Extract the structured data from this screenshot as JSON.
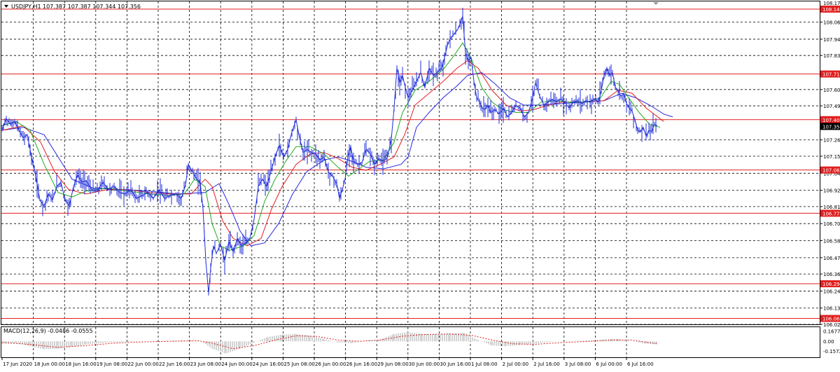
{
  "header": {
    "symbol_tf": "USDJPY,H1",
    "ohlc": "107.387 107.387 107.344 107.356",
    "dropdown_icon": "triangle-down-icon"
  },
  "macd_label": "MACD(12,26,9) -0.0486 -0.0555",
  "colors": {
    "price": "#1f2dd8",
    "ma_green": "#1faa1f",
    "ma_red": "#e02020",
    "ma_blue": "#2828e0",
    "level_line": "#e02020",
    "level_box": "#e02020",
    "current_box": "#000000",
    "grid": "#000000",
    "macd_hist": "#a8a8a8",
    "macd_signal": "#e02020"
  },
  "chart_data": {
    "type": "line",
    "title": "",
    "xlabel": "",
    "ylabel": "",
    "ylim": [
      106.02,
      108.2
    ],
    "price_axis_labels": [
      "108.060",
      "107.945",
      "107.835",
      "107.605",
      "107.495",
      "107.265",
      "107.155",
      "107.040",
      "106.925",
      "106.815",
      "106.700",
      "106.585",
      "106.470",
      "106.360",
      "106.245",
      "106.130",
      "106.020"
    ],
    "top_cut_label": "108.170",
    "level_lines": [
      "108.148",
      "107.710",
      "107.402",
      "107.062",
      "106.770",
      "106.294",
      "106.060"
    ],
    "current_price": "107.356",
    "time_labels": [
      "17 Jun 2020",
      "18 Jun 00:00",
      "18 Jun 16:00",
      "19 Jun 08:00",
      "22 Jun 00:00",
      "22 Jun 16:00",
      "23 Jun 08:00",
      "24 Jun 00:00",
      "24 Jun 16:00",
      "25 Jun 08:00",
      "26 Jun 00:00",
      "26 Jun 16:00",
      "29 Jun 08:00",
      "30 Jun 00:00",
      "30 Jun 16:00",
      "1 Jul 08:00",
      "2 Jul 00:00",
      "2 Jul 16:00",
      "3 Jul 08:00",
      "6 Jul 00:00",
      "6 Jul 16:00"
    ],
    "price_series": [
      [
        0,
        107.33
      ],
      [
        6,
        107.41
      ],
      [
        12,
        107.37
      ],
      [
        18,
        107.39
      ],
      [
        24,
        107.33
      ],
      [
        30,
        107.28
      ],
      [
        36,
        107.3
      ],
      [
        42,
        107.15
      ],
      [
        48,
        107.02
      ],
      [
        54,
        106.86
      ],
      [
        60,
        106.82
      ],
      [
        66,
        106.9
      ],
      [
        72,
        106.86
      ],
      [
        78,
        106.95
      ],
      [
        84,
        106.98
      ],
      [
        90,
        106.86
      ],
      [
        96,
        106.82
      ],
      [
        102,
        106.95
      ],
      [
        108,
        107.03
      ],
      [
        114,
        106.98
      ],
      [
        120,
        106.99
      ],
      [
        128,
        106.93
      ],
      [
        136,
        106.92
      ],
      [
        144,
        106.98
      ],
      [
        152,
        106.93
      ],
      [
        160,
        106.95
      ],
      [
        168,
        106.91
      ],
      [
        176,
        106.9
      ],
      [
        184,
        106.93
      ],
      [
        192,
        106.87
      ],
      [
        200,
        106.89
      ],
      [
        208,
        106.91
      ],
      [
        216,
        106.87
      ],
      [
        224,
        106.93
      ],
      [
        232,
        106.87
      ],
      [
        240,
        106.89
      ],
      [
        248,
        106.9
      ],
      [
        256,
        106.87
      ],
      [
        262,
        106.96
      ],
      [
        266,
        107.1
      ],
      [
        272,
        107.05
      ],
      [
        278,
        107.0
      ],
      [
        283,
        106.98
      ],
      [
        287,
        106.8
      ],
      [
        291,
        106.45
      ],
      [
        295,
        106.23
      ],
      [
        298,
        106.4
      ],
      [
        302,
        106.55
      ],
      [
        306,
        106.5
      ],
      [
        312,
        106.56
      ],
      [
        318,
        106.45
      ],
      [
        324,
        106.58
      ],
      [
        330,
        106.51
      ],
      [
        336,
        106.6
      ],
      [
        342,
        106.55
      ],
      [
        348,
        106.57
      ],
      [
        354,
        106.6
      ],
      [
        360,
        106.73
      ],
      [
        366,
        106.95
      ],
      [
        372,
        107.0
      ],
      [
        378,
        106.95
      ],
      [
        384,
        107.05
      ],
      [
        390,
        107.15
      ],
      [
        396,
        107.23
      ],
      [
        402,
        107.15
      ],
      [
        408,
        107.2
      ],
      [
        414,
        107.32
      ],
      [
        420,
        107.4
      ],
      [
        424,
        107.3
      ],
      [
        430,
        107.18
      ],
      [
        436,
        107.2
      ],
      [
        442,
        107.18
      ],
      [
        448,
        107.17
      ],
      [
        454,
        107.13
      ],
      [
        460,
        107.15
      ],
      [
        466,
        107.05
      ],
      [
        472,
        107.02
      ],
      [
        478,
        106.97
      ],
      [
        482,
        106.87
      ],
      [
        486,
        106.93
      ],
      [
        490,
        107.0
      ],
      [
        494,
        107.15
      ],
      [
        498,
        107.22
      ],
      [
        502,
        107.12
      ],
      [
        508,
        107.1
      ],
      [
        514,
        107.11
      ],
      [
        520,
        107.2
      ],
      [
        526,
        107.17
      ],
      [
        532,
        107.1
      ],
      [
        538,
        107.14
      ],
      [
        544,
        107.12
      ],
      [
        550,
        107.14
      ],
      [
        556,
        107.27
      ],
      [
        560,
        107.48
      ],
      [
        564,
        107.75
      ],
      [
        568,
        107.65
      ],
      [
        572,
        107.7
      ],
      [
        576,
        107.62
      ],
      [
        580,
        107.55
      ],
      [
        586,
        107.6
      ],
      [
        592,
        107.66
      ],
      [
        598,
        107.72
      ],
      [
        604,
        107.62
      ],
      [
        610,
        107.75
      ],
      [
        616,
        107.7
      ],
      [
        622,
        107.72
      ],
      [
        628,
        107.75
      ],
      [
        632,
        107.82
      ],
      [
        636,
        107.9
      ],
      [
        640,
        107.95
      ],
      [
        646,
        107.98
      ],
      [
        652,
        108.02
      ],
      [
        658,
        108.1
      ],
      [
        662,
        107.85
      ],
      [
        666,
        107.8
      ],
      [
        670,
        107.82
      ],
      [
        674,
        107.66
      ],
      [
        678,
        107.55
      ],
      [
        682,
        107.52
      ],
      [
        686,
        107.48
      ],
      [
        690,
        107.47
      ],
      [
        694,
        107.5
      ],
      [
        698,
        107.45
      ],
      [
        704,
        107.47
      ],
      [
        710,
        107.44
      ],
      [
        716,
        107.48
      ],
      [
        722,
        107.42
      ],
      [
        728,
        107.45
      ],
      [
        734,
        107.5
      ],
      [
        740,
        107.48
      ],
      [
        746,
        107.42
      ],
      [
        752,
        107.45
      ],
      [
        758,
        107.55
      ],
      [
        762,
        107.65
      ],
      [
        768,
        107.56
      ],
      [
        774,
        107.5
      ],
      [
        780,
        107.52
      ],
      [
        786,
        107.54
      ],
      [
        792,
        107.52
      ],
      [
        798,
        107.54
      ],
      [
        804,
        107.52
      ],
      [
        810,
        107.48
      ],
      [
        816,
        107.52
      ],
      [
        822,
        107.53
      ],
      [
        828,
        107.51
      ],
      [
        834,
        107.53
      ],
      [
        840,
        107.52
      ],
      [
        846,
        107.54
      ],
      [
        852,
        107.52
      ],
      [
        856,
        107.6
      ],
      [
        860,
        107.7
      ],
      [
        864,
        107.75
      ],
      [
        868,
        107.7
      ],
      [
        872,
        107.72
      ],
      [
        876,
        107.62
      ],
      [
        880,
        107.6
      ],
      [
        884,
        107.56
      ],
      [
        888,
        107.58
      ],
      [
        892,
        107.51
      ],
      [
        896,
        107.48
      ],
      [
        900,
        107.46
      ],
      [
        904,
        107.4
      ],
      [
        908,
        107.33
      ],
      [
        912,
        107.32
      ],
      [
        916,
        107.35
      ],
      [
        920,
        107.29
      ],
      [
        924,
        107.33
      ],
      [
        928,
        107.32
      ],
      [
        932,
        107.37
      ],
      [
        936,
        107.36
      ]
    ],
    "ma_fast": [
      [
        0,
        107.36
      ],
      [
        20,
        107.39
      ],
      [
        40,
        107.33
      ],
      [
        60,
        107.1
      ],
      [
        80,
        106.91
      ],
      [
        100,
        106.88
      ],
      [
        120,
        106.92
      ],
      [
        150,
        106.94
      ],
      [
        180,
        106.92
      ],
      [
        210,
        106.9
      ],
      [
        240,
        106.89
      ],
      [
        260,
        106.9
      ],
      [
        275,
        107.0
      ],
      [
        290,
        106.95
      ],
      [
        300,
        106.7
      ],
      [
        312,
        106.55
      ],
      [
        325,
        106.52
      ],
      [
        345,
        106.55
      ],
      [
        360,
        106.62
      ],
      [
        375,
        106.85
      ],
      [
        390,
        107.0
      ],
      [
        405,
        107.12
      ],
      [
        420,
        107.22
      ],
      [
        440,
        107.22
      ],
      [
        460,
        107.17
      ],
      [
        480,
        107.08
      ],
      [
        495,
        107.02
      ],
      [
        510,
        107.07
      ],
      [
        525,
        107.12
      ],
      [
        545,
        107.13
      ],
      [
        560,
        107.25
      ],
      [
        572,
        107.45
      ],
      [
        590,
        107.6
      ],
      [
        610,
        107.66
      ],
      [
        630,
        107.74
      ],
      [
        645,
        107.83
      ],
      [
        658,
        107.92
      ],
      [
        670,
        107.82
      ],
      [
        685,
        107.62
      ],
      [
        700,
        107.52
      ],
      [
        715,
        107.47
      ],
      [
        735,
        107.45
      ],
      [
        752,
        107.45
      ],
      [
        770,
        107.52
      ],
      [
        790,
        107.53
      ],
      [
        810,
        107.52
      ],
      [
        835,
        107.52
      ],
      [
        855,
        107.55
      ],
      [
        870,
        107.66
      ],
      [
        882,
        107.64
      ],
      [
        895,
        107.55
      ],
      [
        910,
        107.45
      ],
      [
        925,
        107.37
      ],
      [
        940,
        107.35
      ]
    ],
    "ma_mid": [
      [
        0,
        107.33
      ],
      [
        30,
        107.36
      ],
      [
        55,
        107.25
      ],
      [
        75,
        107.05
      ],
      [
        95,
        106.93
      ],
      [
        120,
        106.9
      ],
      [
        150,
        106.93
      ],
      [
        180,
        106.93
      ],
      [
        210,
        106.91
      ],
      [
        240,
        106.9
      ],
      [
        270,
        106.9
      ],
      [
        290,
        107.0
      ],
      [
        300,
        106.95
      ],
      [
        315,
        106.72
      ],
      [
        330,
        106.6
      ],
      [
        350,
        106.55
      ],
      [
        370,
        106.6
      ],
      [
        385,
        106.8
      ],
      [
        400,
        106.95
      ],
      [
        420,
        107.1
      ],
      [
        440,
        107.17
      ],
      [
        460,
        107.18
      ],
      [
        480,
        107.14
      ],
      [
        500,
        107.08
      ],
      [
        520,
        107.06
      ],
      [
        540,
        107.1
      ],
      [
        560,
        107.15
      ],
      [
        575,
        107.3
      ],
      [
        590,
        107.5
      ],
      [
        610,
        107.58
      ],
      [
        630,
        107.66
      ],
      [
        650,
        107.75
      ],
      [
        665,
        107.8
      ],
      [
        680,
        107.75
      ],
      [
        700,
        107.6
      ],
      [
        720,
        107.5
      ],
      [
        740,
        107.46
      ],
      [
        760,
        107.47
      ],
      [
        780,
        107.5
      ],
      [
        800,
        107.52
      ],
      [
        830,
        107.52
      ],
      [
        860,
        107.53
      ],
      [
        880,
        107.6
      ],
      [
        900,
        107.58
      ],
      [
        920,
        107.48
      ],
      [
        945,
        107.39
      ]
    ],
    "ma_slow": [
      [
        0,
        107.33
      ],
      [
        30,
        107.35
      ],
      [
        60,
        107.3
      ],
      [
        80,
        107.15
      ],
      [
        100,
        107.0
      ],
      [
        130,
        106.94
      ],
      [
        170,
        106.93
      ],
      [
        210,
        106.92
      ],
      [
        250,
        106.9
      ],
      [
        290,
        106.91
      ],
      [
        310,
        106.97
      ],
      [
        325,
        106.82
      ],
      [
        340,
        106.65
      ],
      [
        355,
        106.55
      ],
      [
        375,
        106.57
      ],
      [
        395,
        106.7
      ],
      [
        415,
        106.9
      ],
      [
        435,
        107.05
      ],
      [
        460,
        107.13
      ],
      [
        480,
        107.15
      ],
      [
        500,
        107.12
      ],
      [
        520,
        107.08
      ],
      [
        545,
        107.07
      ],
      [
        570,
        107.1
      ],
      [
        580,
        107.15
      ],
      [
        592,
        107.35
      ],
      [
        610,
        107.45
      ],
      [
        630,
        107.55
      ],
      [
        650,
        107.63
      ],
      [
        665,
        107.7
      ],
      [
        685,
        107.72
      ],
      [
        705,
        107.64
      ],
      [
        725,
        107.55
      ],
      [
        745,
        107.5
      ],
      [
        770,
        107.5
      ],
      [
        800,
        107.51
      ],
      [
        830,
        107.52
      ],
      [
        860,
        107.53
      ],
      [
        885,
        107.58
      ],
      [
        905,
        107.55
      ],
      [
        925,
        107.5
      ],
      [
        945,
        107.44
      ],
      [
        958,
        107.42
      ]
    ],
    "macd_hist": [
      [
        0,
        -0.04
      ],
      [
        20,
        -0.03
      ],
      [
        40,
        -0.08
      ],
      [
        60,
        -0.13
      ],
      [
        80,
        -0.12
      ],
      [
        100,
        -0.09
      ],
      [
        120,
        -0.05
      ],
      [
        150,
        -0.02
      ],
      [
        180,
        -0.01
      ],
      [
        210,
        0.0
      ],
      [
        240,
        0.01
      ],
      [
        270,
        0.02
      ],
      [
        285,
        0.0
      ],
      [
        300,
        -0.12
      ],
      [
        320,
        -0.2
      ],
      [
        340,
        -0.12
      ],
      [
        360,
        -0.02
      ],
      [
        380,
        0.07
      ],
      [
        400,
        0.11
      ],
      [
        420,
        0.12
      ],
      [
        440,
        0.09
      ],
      [
        460,
        0.04
      ],
      [
        480,
        -0.02
      ],
      [
        500,
        -0.03
      ],
      [
        520,
        0.01
      ],
      [
        540,
        0.03
      ],
      [
        560,
        0.12
      ],
      [
        580,
        0.15
      ],
      [
        600,
        0.12
      ],
      [
        620,
        0.12
      ],
      [
        640,
        0.13
      ],
      [
        660,
        0.14
      ],
      [
        680,
        0.02
      ],
      [
        700,
        -0.07
      ],
      [
        720,
        -0.08
      ],
      [
        740,
        -0.06
      ],
      [
        760,
        -0.04
      ],
      [
        780,
        -0.01
      ],
      [
        800,
        0.0
      ],
      [
        830,
        0.01
      ],
      [
        860,
        0.03
      ],
      [
        880,
        0.04
      ],
      [
        900,
        0.0
      ],
      [
        920,
        -0.04
      ],
      [
        936,
        -0.05
      ]
    ],
    "macd_signal": [
      [
        0,
        -0.02
      ],
      [
        40,
        -0.05
      ],
      [
        80,
        -0.1
      ],
      [
        120,
        -0.07
      ],
      [
        160,
        -0.03
      ],
      [
        200,
        -0.01
      ],
      [
        240,
        0.0
      ],
      [
        280,
        0.01
      ],
      [
        300,
        -0.03
      ],
      [
        330,
        -0.12
      ],
      [
        360,
        -0.07
      ],
      [
        390,
        0.02
      ],
      [
        420,
        0.09
      ],
      [
        450,
        0.08
      ],
      [
        480,
        0.02
      ],
      [
        510,
        0.0
      ],
      [
        540,
        0.02
      ],
      [
        570,
        0.08
      ],
      [
        600,
        0.11
      ],
      [
        640,
        0.12
      ],
      [
        670,
        0.1
      ],
      [
        700,
        0.02
      ],
      [
        730,
        -0.04
      ],
      [
        760,
        -0.05
      ],
      [
        800,
        -0.02
      ],
      [
        840,
        0.0
      ],
      [
        870,
        0.02
      ],
      [
        900,
        0.02
      ],
      [
        936,
        -0.04
      ]
    ],
    "macd_axis_labels": [
      "0.1677",
      "0.00",
      "-0.1572"
    ],
    "macd_ylim": [
      -0.25,
      0.22
    ]
  }
}
